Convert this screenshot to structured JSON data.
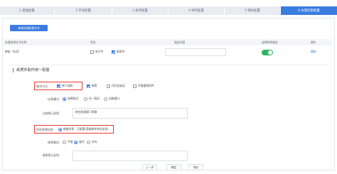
{
  "steps": [
    {
      "label": "1 基础配置",
      "active": false
    },
    {
      "label": "2 字段配置",
      "active": false
    },
    {
      "label": "3 表单配置",
      "active": false
    },
    {
      "label": "4 材料配置",
      "active": false
    },
    {
      "label": "5 情形配置",
      "active": false
    },
    {
      "label": "6 办理结果配置",
      "active": true
    }
  ],
  "new_button": "新增办理结果文书",
  "table": {
    "headers": {
      "name": "办理结果文书名称",
      "type": "类型",
      "desc": "描述内容",
      "mail": "选择邮寄服务",
      "op": "操作"
    },
    "row": {
      "name": "审核（社员）",
      "type_options": [
        {
          "label": "电子件",
          "checked": false
        },
        {
          "label": "纸质件",
          "checked": true
        }
      ],
      "desc": "",
      "mail_enabled": true,
      "action": "删除"
    }
  },
  "section_title": "纸质件取件统一配置",
  "pickup": {
    "label": "取件方式：",
    "options": [
      {
        "label": "线下自取",
        "checked": true
      },
      {
        "label": "邮寄",
        "checked": true
      },
      {
        "label": "代办员送达",
        "checked": false
      },
      {
        "label": "不需要纸质件",
        "checked": false
      }
    ]
  },
  "self_mode": {
    "label": "自取模式：",
    "options": [
      {
        "label": "选择网点",
        "on": true
      },
      {
        "label": "任一网点",
        "on": false
      },
      {
        "label": "自取窗口",
        "on": false
      }
    ]
  },
  "self_desc": {
    "label": "自取提示说明：",
    "value": "前往民政部门领取"
  },
  "sync": {
    "label": "同步收费信息：",
    "option": "根据共享",
    "link": "已配置(获取取件地址信息)"
  },
  "mail": {
    "label": "邮寄服务：",
    "options": [
      {
        "label": "不限",
        "on": false
      },
      {
        "label": "省内",
        "on": true
      },
      {
        "label": "市内",
        "on": false
      }
    ]
  },
  "mail_desc": {
    "label": "邮寄提示说明：",
    "value": ""
  },
  "footer": {
    "prev": "上一步",
    "confirm": "确定",
    "save": "保存"
  },
  "colors": {
    "primary": "#3b7be0",
    "highlight": "#e53935",
    "toggle": "#2db55d"
  }
}
